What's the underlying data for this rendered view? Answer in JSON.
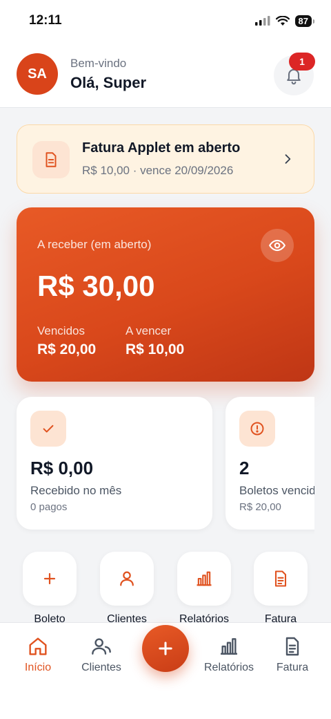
{
  "status_bar": {
    "time": "12:11",
    "battery": "87"
  },
  "header": {
    "avatar_initials": "SA",
    "greeting_sub": "Bem-vindo",
    "greeting_main": "Olá, Super",
    "notification_count": "1"
  },
  "invoice_banner": {
    "title": "Fatura Applet em aberto",
    "subtitle": "R$ 10,00 · vence 20/09/2026"
  },
  "receivable": {
    "label": "A receber (em aberto)",
    "amount": "R$ 30,00",
    "overdue_label": "Vencidos",
    "overdue_value": "R$ 20,00",
    "upcoming_label": "A vencer",
    "upcoming_value": "R$ 10,00"
  },
  "stats": [
    {
      "value": "R$ 0,00",
      "label": "Recebido no mês",
      "sub": "0 pagos",
      "icon": "check-icon"
    },
    {
      "value": "2",
      "label": "Boletos vencidos",
      "sub": "R$ 20,00",
      "icon": "alert-circle-icon"
    }
  ],
  "quick_actions": [
    {
      "label": "Boleto",
      "icon": "plus-icon"
    },
    {
      "label": "Clientes",
      "icon": "user-icon"
    },
    {
      "label": "Relatórios",
      "icon": "chart-icon"
    },
    {
      "label": "Fatura",
      "icon": "document-icon"
    }
  ],
  "tabs": [
    {
      "label": "Início",
      "icon": "home-icon",
      "active": true
    },
    {
      "label": "Clientes",
      "icon": "users-icon",
      "active": false
    },
    {
      "label": "Relatórios",
      "icon": "chart-icon",
      "active": false
    },
    {
      "label": "Fatura",
      "icon": "document-icon",
      "active": false
    }
  ],
  "colors": {
    "accent": "#e0521f",
    "accent_dark": "#c93d16",
    "badge": "#dc2626",
    "banner_bg": "#fef3e2"
  }
}
